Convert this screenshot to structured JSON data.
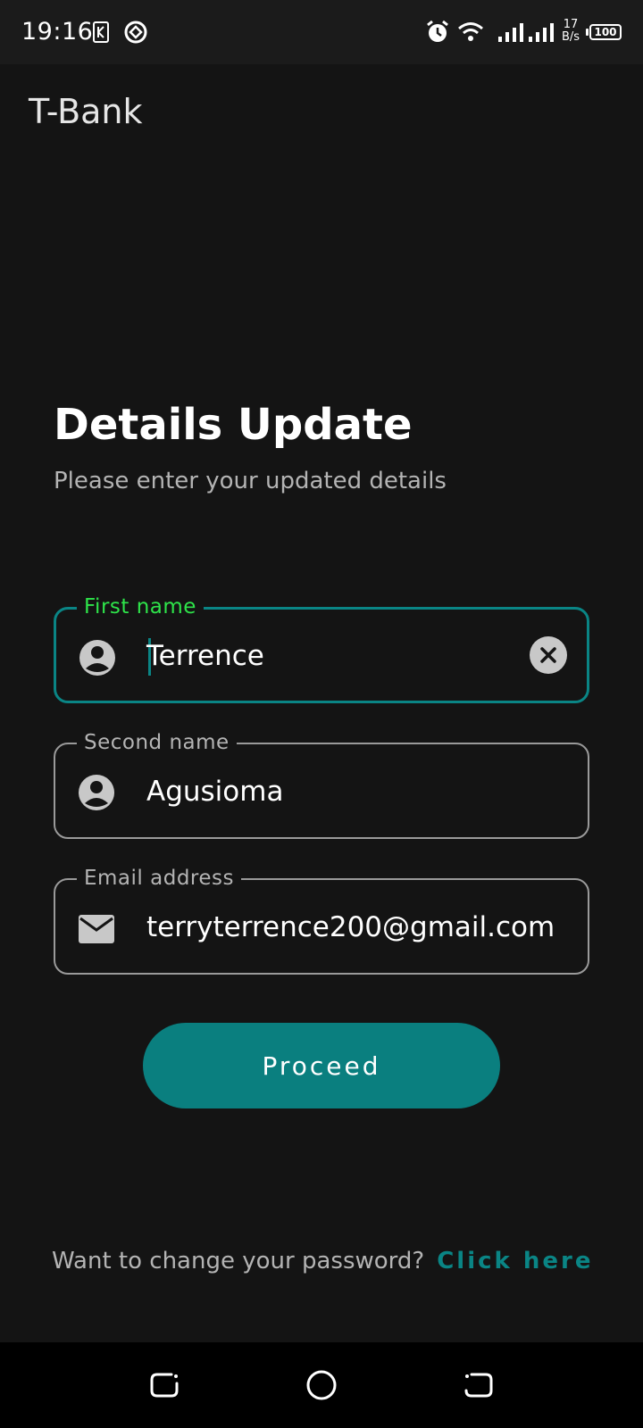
{
  "status_bar": {
    "time": "19:16",
    "net_speed_value": "17",
    "net_speed_unit": "B/s",
    "battery": "100",
    "icons": [
      "sim-card-icon",
      "assistant-icon",
      "alarm-icon",
      "wifi-icon",
      "signal-icon",
      "signal-icon",
      "battery-icon"
    ]
  },
  "app": {
    "title": "T-Bank"
  },
  "header": {
    "title": "Details Update",
    "subtitle": "Please enter your updated details"
  },
  "form": {
    "first_name": {
      "label": "First name",
      "value": "Terrence",
      "icon": "person-icon",
      "focused": true
    },
    "second_name": {
      "label": "Second name",
      "value": "Agusioma",
      "icon": "person-icon"
    },
    "email": {
      "label": "Email address",
      "value": "terryterrence200@gmail.com",
      "icon": "mail-icon"
    }
  },
  "actions": {
    "proceed_label": "Proceed"
  },
  "footer": {
    "prompt": "Want to change your password?",
    "link_label": "Click here"
  },
  "colors": {
    "background": "#141414",
    "accent": "#0a8585",
    "focused_label": "#2ee44a",
    "button": "#0a7f7f"
  },
  "nav": {
    "icons": [
      "recents-icon",
      "home-icon",
      "back-icon"
    ]
  }
}
